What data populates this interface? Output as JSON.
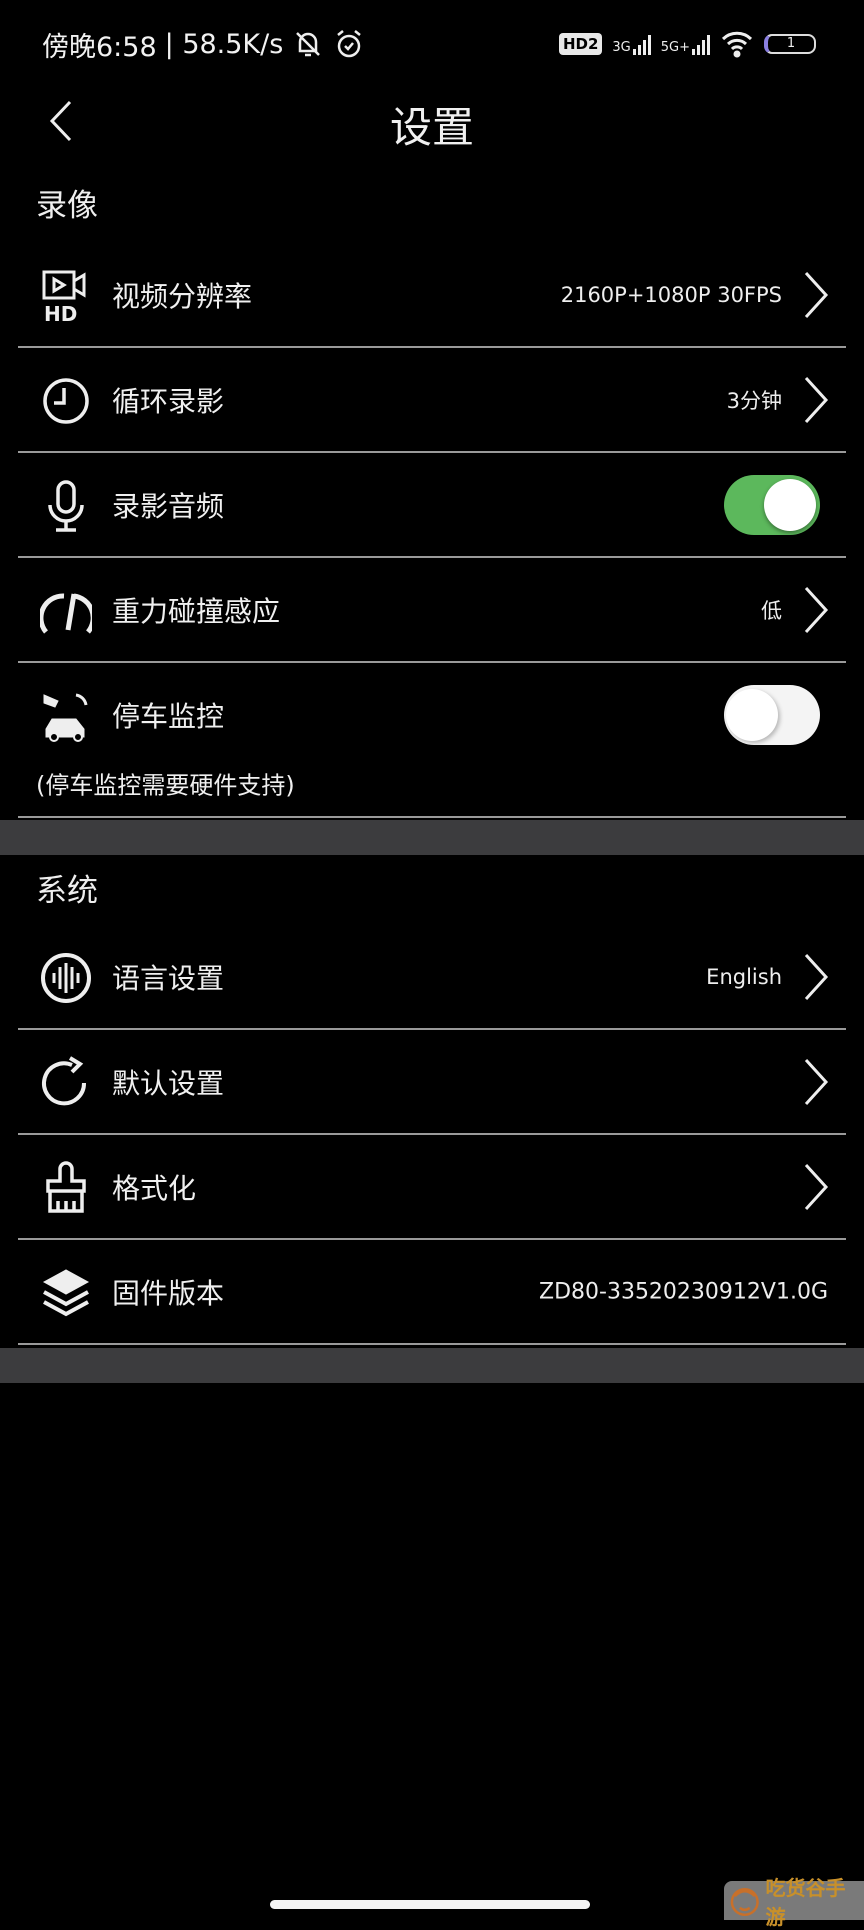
{
  "status_bar": {
    "time": "傍晚6:58",
    "speed": "| 58.5K/s",
    "hd_badge": "HD2",
    "net1": "3G",
    "net2": "5G+",
    "battery": "1"
  },
  "header": {
    "title": "设置"
  },
  "sections": [
    {
      "title": "录像",
      "rows": [
        {
          "label": "视频分辨率",
          "value": "2160P+1080P 30FPS",
          "icon": "video-hd-icon"
        },
        {
          "label": "循环录影",
          "value": "3分钟",
          "icon": "clock-icon"
        },
        {
          "label": "录影音频",
          "toggle": true,
          "icon": "microphone-icon"
        },
        {
          "label": "重力碰撞感应",
          "value": "低",
          "icon": "gauge-icon"
        },
        {
          "label": "停车监控",
          "toggle": false,
          "icon": "parking-monitor-icon"
        }
      ],
      "note": "(停车监控需要硬件支持)"
    },
    {
      "title": "系统",
      "rows": [
        {
          "label": "语言设置",
          "value": "English",
          "icon": "audio-wave-icon"
        },
        {
          "label": "默认设置",
          "icon": "refresh-icon"
        },
        {
          "label": "格式化",
          "icon": "brush-icon"
        },
        {
          "label": "固件版本",
          "value": "ZD80-33520230912V1.0G",
          "icon": "layers-icon"
        }
      ]
    }
  ],
  "colors": {
    "toggle_on": "#5cb85c",
    "band": "#3c3c3e",
    "divider": "#9a9a9a"
  },
  "watermark": "吃货谷手游"
}
